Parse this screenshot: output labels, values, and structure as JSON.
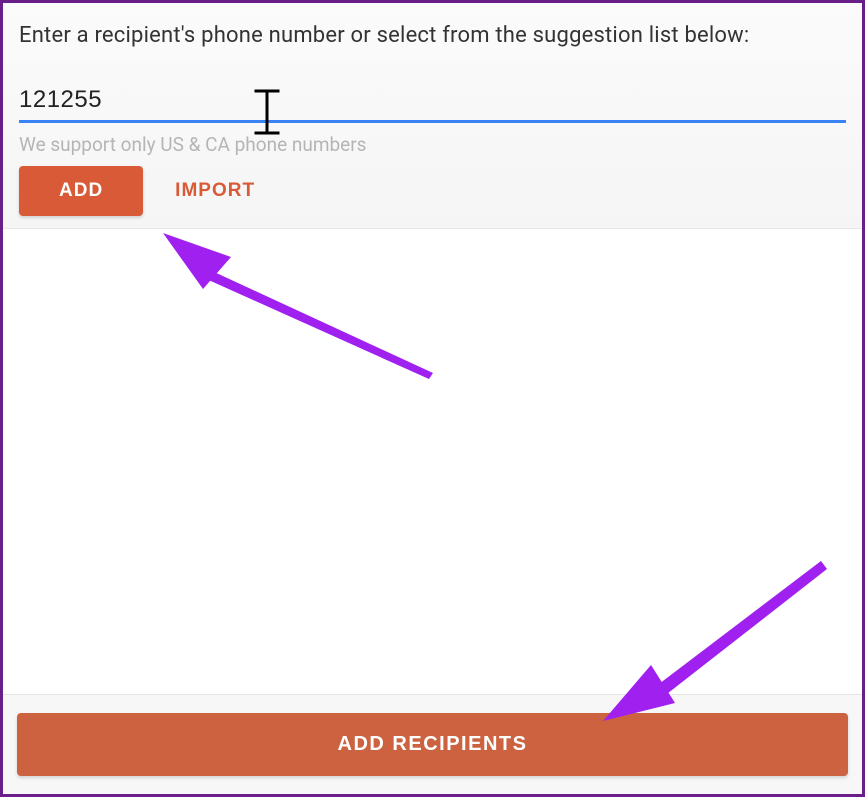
{
  "form": {
    "prompt": "Enter a recipient's phone number or select from the suggestion list below:",
    "phone_value": "121255",
    "hint": "We support only US & CA phone numbers",
    "add_label": "ADD",
    "import_label": "IMPORT"
  },
  "footer": {
    "add_recipients_label": "ADD RECIPIENTS"
  },
  "colors": {
    "primary": "#d85a36",
    "input_underline": "#3b82f6",
    "annotation": "#a020f0"
  }
}
